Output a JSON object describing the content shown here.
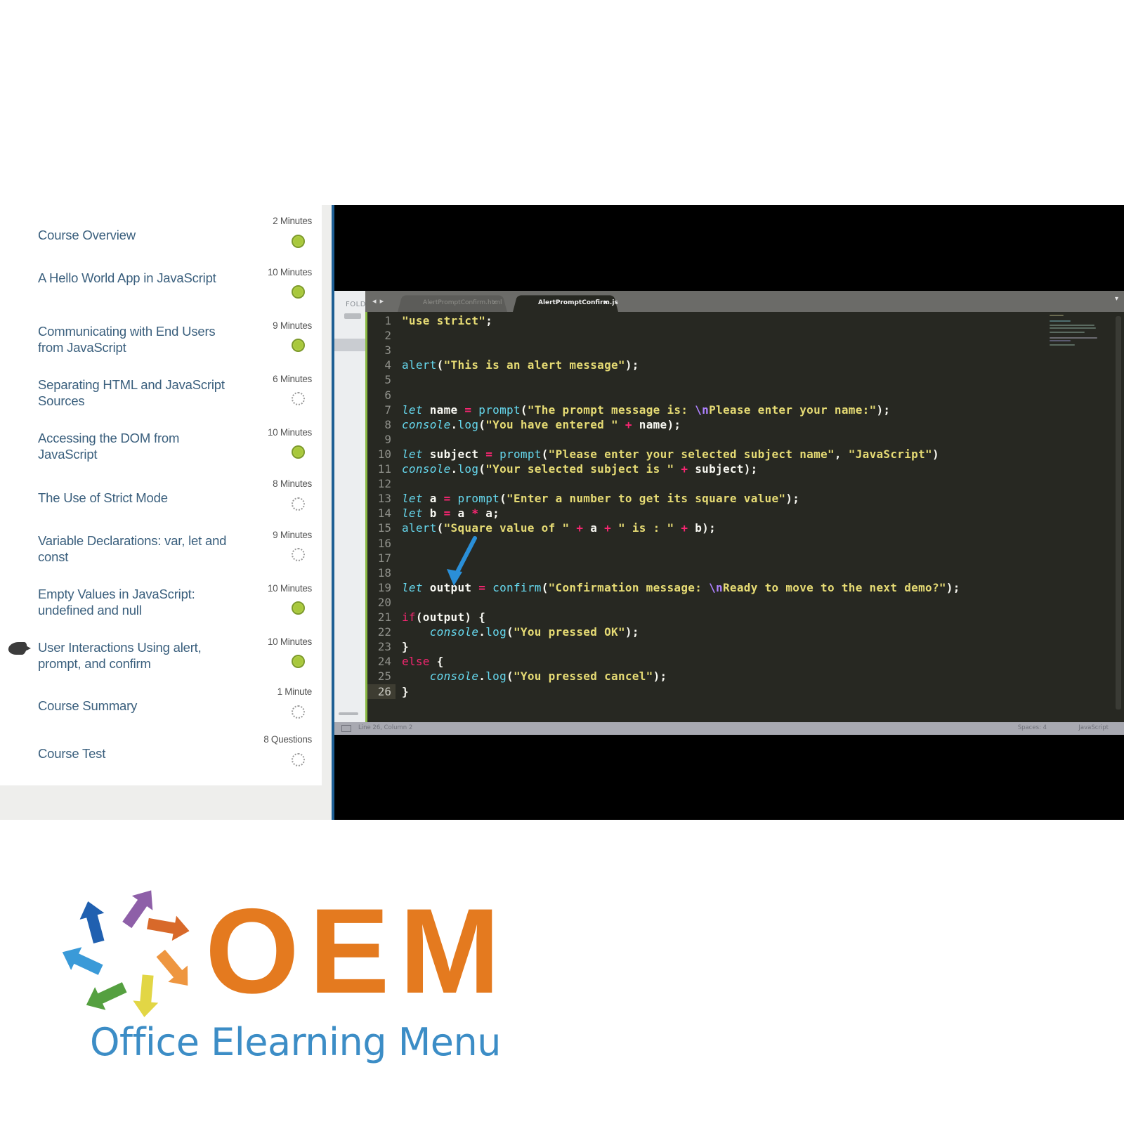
{
  "sidebar": {
    "lessons": [
      {
        "title": "Course Overview",
        "duration": "2 Minutes",
        "status": "completed"
      },
      {
        "title": "A Hello World App in JavaScript",
        "duration": "10 Minutes",
        "status": "completed"
      },
      {
        "title": "Communicating with End Users from JavaScript",
        "duration": "9 Minutes",
        "status": "completed"
      },
      {
        "title": "Separating HTML and JavaScript Sources",
        "duration": "6 Minutes",
        "status": "not-started"
      },
      {
        "title": "Accessing the DOM from JavaScript",
        "duration": "10 Minutes",
        "status": "completed"
      },
      {
        "title": "The Use of Strict Mode",
        "duration": "8 Minutes",
        "status": "not-started"
      },
      {
        "title": "Variable Declarations: var, let and const",
        "duration": "9 Minutes",
        "status": "not-started"
      },
      {
        "title": "Empty Values in JavaScript: undefined and null",
        "duration": "10 Minutes",
        "status": "completed"
      },
      {
        "title": "User Interactions Using alert, prompt, and confirm",
        "duration": "10 Minutes",
        "status": "completed",
        "current": true
      },
      {
        "title": "Course Summary",
        "duration": "1 Minute",
        "status": "not-started"
      },
      {
        "title": "Course Test",
        "duration": "8 Questions",
        "status": "not-started"
      }
    ]
  },
  "editor": {
    "folder_label": "FOLD",
    "tab_arrows": "◂ ▸",
    "tabs": [
      {
        "label": "AlertPromptConfirm.html",
        "active": false,
        "close": "×"
      },
      {
        "label": "AlertPromptConfirm.js",
        "active": true,
        "close": "×"
      }
    ],
    "tab_dropdown": "▾",
    "active_line": 26,
    "lines": [
      [
        [
          "str",
          "\"use strict\""
        ],
        [
          "id",
          ";"
        ]
      ],
      [],
      [],
      [
        [
          "fn",
          "alert"
        ],
        [
          "id",
          "("
        ],
        [
          "str",
          "\"This is an alert message\""
        ],
        [
          "id",
          ");"
        ]
      ],
      [],
      [],
      [
        [
          "kw",
          "let"
        ],
        [
          "id",
          " name "
        ],
        [
          "op",
          "="
        ],
        [
          "id",
          " "
        ],
        [
          "fn",
          "prompt"
        ],
        [
          "id",
          "("
        ],
        [
          "str",
          "\"The prompt message is: "
        ],
        [
          "esc",
          "\\n"
        ],
        [
          "str",
          "Please enter your name:\""
        ],
        [
          "id",
          ");"
        ]
      ],
      [
        [
          "obj",
          "console"
        ],
        [
          "id",
          "."
        ],
        [
          "fn",
          "log"
        ],
        [
          "id",
          "("
        ],
        [
          "str",
          "\"You have entered \""
        ],
        [
          "id",
          " "
        ],
        [
          "op",
          "+"
        ],
        [
          "id",
          " name);"
        ]
      ],
      [],
      [
        [
          "kw",
          "let"
        ],
        [
          "id",
          " subject "
        ],
        [
          "op",
          "="
        ],
        [
          "id",
          " "
        ],
        [
          "fn",
          "prompt"
        ],
        [
          "id",
          "("
        ],
        [
          "str",
          "\"Please enter your selected subject name\""
        ],
        [
          "id",
          ", "
        ],
        [
          "str",
          "\"JavaScript\""
        ],
        [
          "id",
          ")"
        ]
      ],
      [
        [
          "obj",
          "console"
        ],
        [
          "id",
          "."
        ],
        [
          "fn",
          "log"
        ],
        [
          "id",
          "("
        ],
        [
          "str",
          "\"Your selected subject is \""
        ],
        [
          "id",
          " "
        ],
        [
          "op",
          "+"
        ],
        [
          "id",
          " subject);"
        ]
      ],
      [],
      [
        [
          "kw",
          "let"
        ],
        [
          "id",
          " a "
        ],
        [
          "op",
          "="
        ],
        [
          "id",
          " "
        ],
        [
          "fn",
          "prompt"
        ],
        [
          "id",
          "("
        ],
        [
          "str",
          "\"Enter a number to get its square value\""
        ],
        [
          "id",
          ");"
        ]
      ],
      [
        [
          "kw",
          "let"
        ],
        [
          "id",
          " b "
        ],
        [
          "op",
          "="
        ],
        [
          "id",
          " a "
        ],
        [
          "op",
          "*"
        ],
        [
          "id",
          " a;"
        ]
      ],
      [
        [
          "fn",
          "alert"
        ],
        [
          "id",
          "("
        ],
        [
          "str",
          "\"Square value of \""
        ],
        [
          "id",
          " "
        ],
        [
          "op",
          "+"
        ],
        [
          "id",
          " a "
        ],
        [
          "op",
          "+"
        ],
        [
          "id",
          " "
        ],
        [
          "str",
          "\" is : \""
        ],
        [
          "id",
          " "
        ],
        [
          "op",
          "+"
        ],
        [
          "id",
          " b);"
        ]
      ],
      [],
      [],
      [],
      [
        [
          "kw",
          "let"
        ],
        [
          "id",
          " output "
        ],
        [
          "op",
          "="
        ],
        [
          "id",
          " "
        ],
        [
          "fn",
          "confirm"
        ],
        [
          "id",
          "("
        ],
        [
          "str",
          "\"Confirmation message: "
        ],
        [
          "esc",
          "\\n"
        ],
        [
          "str",
          "Ready to move to the next demo?\""
        ],
        [
          "id",
          ");"
        ]
      ],
      [],
      [
        [
          "ctl",
          "if"
        ],
        [
          "id",
          "(output) {"
        ]
      ],
      [
        [
          "id",
          "    "
        ],
        [
          "obj",
          "console"
        ],
        [
          "id",
          "."
        ],
        [
          "fn",
          "log"
        ],
        [
          "id",
          "("
        ],
        [
          "str",
          "\"You pressed OK\""
        ],
        [
          "id",
          ");"
        ]
      ],
      [
        [
          "id",
          "}"
        ]
      ],
      [
        [
          "ctl",
          "else"
        ],
        [
          "id",
          " {"
        ]
      ],
      [
        [
          "id",
          "    "
        ],
        [
          "obj",
          "console"
        ],
        [
          "id",
          "."
        ],
        [
          "fn",
          "log"
        ],
        [
          "id",
          "("
        ],
        [
          "str",
          "\"You pressed cancel\""
        ],
        [
          "id",
          ");"
        ]
      ],
      [
        [
          "id",
          "}"
        ]
      ]
    ],
    "status": {
      "position": "Line 26, Column 2",
      "indentation": "Spaces: 4",
      "syntax": "JavaScript"
    },
    "annotation_color": "#2a8fd8"
  },
  "colors": {
    "completed": "#a8c83c",
    "title_text": "#3a5f7d",
    "accent_blue": "#1e5f94"
  },
  "logo": {
    "wordmark": "OEM",
    "tagline": "Office Elearning Menu",
    "wordmark_color": "#e47a1f",
    "tagline_color": "#3c8dc6",
    "arrow_colors": [
      "#8e5fa8",
      "#d8692a",
      "#ee9640",
      "#e2d645",
      "#55a040",
      "#3a9ad8",
      "#2060b0"
    ]
  }
}
